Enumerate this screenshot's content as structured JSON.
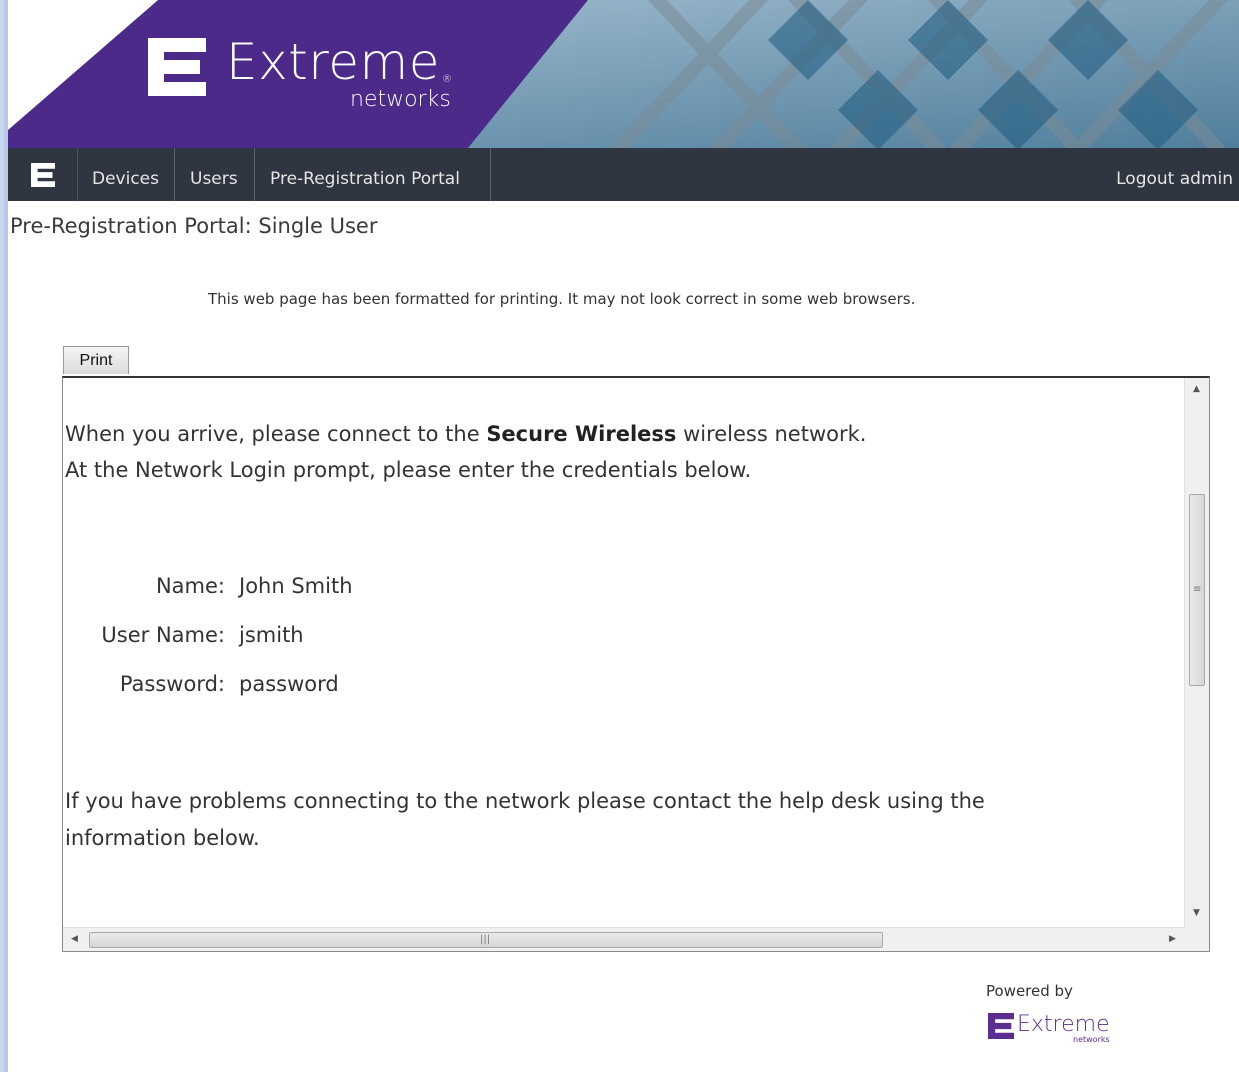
{
  "brand": {
    "name": "Extreme",
    "sub": "networks",
    "reg": "®",
    "purple": "#4b2a8a",
    "nav_bg": "#2f3541"
  },
  "nav": {
    "icon": "extreme-logo-icon",
    "items": [
      {
        "label": "Devices"
      },
      {
        "label": "Users"
      },
      {
        "label": "Pre-Registration Portal"
      }
    ],
    "logout": "Logout admin"
  },
  "page": {
    "title": "Pre-Registration Portal: Single User",
    "notice": "This web page has been formatted for printing. It may not look correct in some web browsers.",
    "print_label": "Print"
  },
  "content": {
    "line1_pre": "When you arrive, please connect to the ",
    "line1_bold": "Secure Wireless",
    "line1_post": " wireless network.",
    "line2": "At the Network Login prompt, please enter the credentials below.",
    "credentials": [
      {
        "label": "Name:",
        "value": "John Smith"
      },
      {
        "label": "User Name:",
        "value": "jsmith"
      },
      {
        "label": "Password:",
        "value": "password"
      }
    ],
    "help_line1": "If you have problems connecting to the network please contact the help desk using the",
    "help_line2": "information below."
  },
  "footer": {
    "powered_by": "Powered by",
    "logo_name": "Extreme",
    "logo_sub": "networks"
  }
}
